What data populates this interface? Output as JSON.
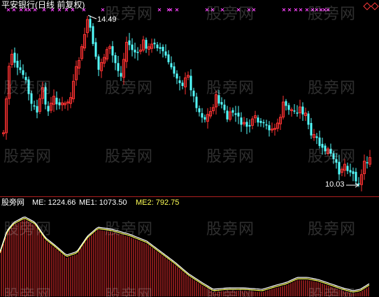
{
  "header": {
    "title": "平安银行(日线 前复权)"
  },
  "main_chart": {
    "high_label": "14.49",
    "low_label": "10.03",
    "colors": {
      "up": "#ff3232",
      "down": "#54ffff",
      "marker": "#ff44ff"
    }
  },
  "indicator": {
    "name": "股旁网",
    "me": "ME: 1224.66",
    "me1": "ME1: 1073.50",
    "me2": "ME2: 792.75",
    "colors": {
      "line1": "#ffffff",
      "line2": "#ffff55",
      "hist": "#ff3232"
    }
  },
  "watermark": {
    "text": "股旁网"
  },
  "nav": {
    "icon": "diamond-icon"
  }
}
